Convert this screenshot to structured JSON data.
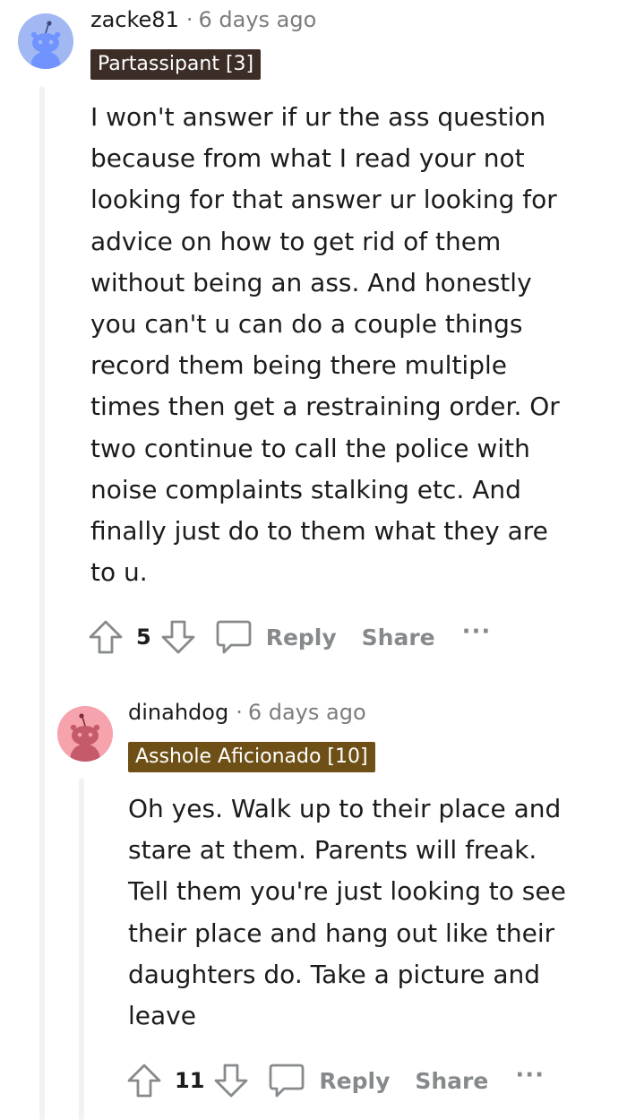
{
  "comments": [
    {
      "username": "zacke81",
      "separator": "·",
      "time": "6 days ago",
      "flair": "Partassipant [3]",
      "flair_color": "#3c2e26",
      "avatar_color": "#7193ff",
      "avatar_bg": "#a2b8f2",
      "body": "I won't answer if ur the ass question\nbecause from what I read your not\nlooking for that answer ur looking for\nadvice on how to get rid of them\nwithout being an ass. And honestly\nyou can't u can do a couple things\nrecord them being there multiple\ntimes then get a restraining order. Or\ntwo continue to call the police with\nnoise complaints stalking etc. And\nfinally just do to them what they are\nto u.",
      "votes": "5",
      "reply_label": "Reply",
      "share_label": "Share",
      "more_label": "···"
    },
    {
      "username": "dinahdog",
      "separator": "·",
      "time": "6 days ago",
      "flair": "Asshole Aficionado [10]",
      "flair_color": "#6e5016",
      "avatar_color": "#ff8395",
      "avatar_bg": "#f6a3ad",
      "body": "Oh yes. Walk up to their place and\nstare at them. Parents will freak.\nTell them you're just looking to see\ntheir place and hang out like their\ndaughters do. Take a picture and\nleave",
      "votes": "11",
      "reply_label": "Reply",
      "share_label": "Share",
      "more_label": "···"
    }
  ]
}
